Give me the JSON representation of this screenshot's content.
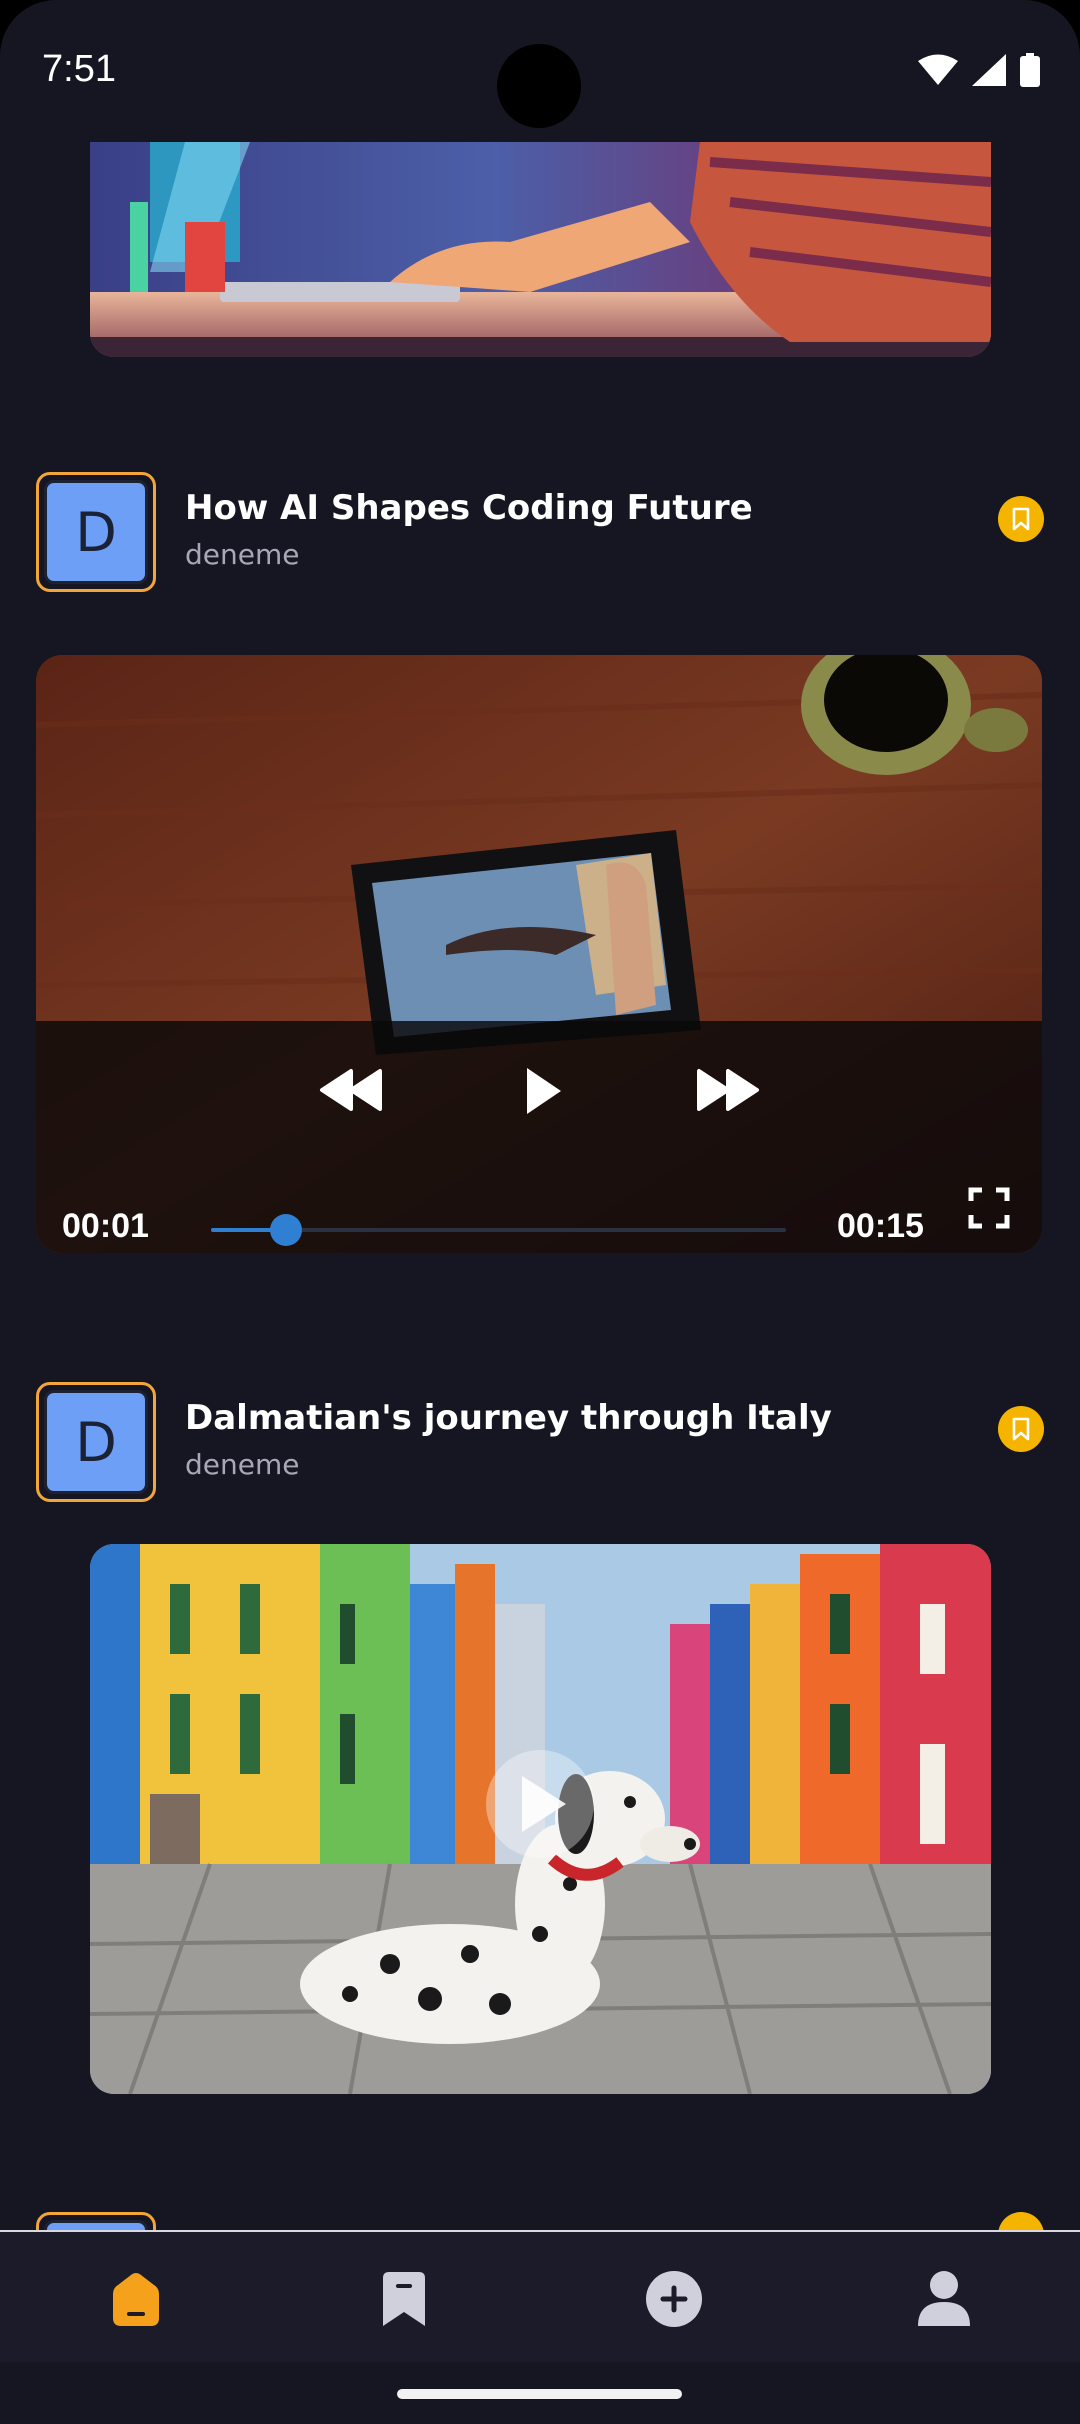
{
  "status_bar": {
    "time": "7:51",
    "icons": [
      "wifi-icon",
      "cellular-signal-icon",
      "battery-icon"
    ]
  },
  "feed": {
    "posts": [
      {
        "title": "How AI Shapes Coding Future",
        "author": "deneme",
        "avatar_letter": "D",
        "bookmarked": true,
        "media_type": "video",
        "player": {
          "current_time": "00:01",
          "duration": "00:15",
          "progress": 0.13
        }
      },
      {
        "title": "Dalmatian's journey through Italy",
        "author": "deneme",
        "avatar_letter": "D",
        "bookmarked": true,
        "media_type": "video-thumbnail"
      }
    ]
  },
  "bottom_nav": {
    "items": [
      {
        "icon": "home-icon",
        "active": true
      },
      {
        "icon": "bookmark-icon",
        "active": false
      },
      {
        "icon": "add-circle-icon",
        "active": false
      },
      {
        "icon": "profile-icon",
        "active": false
      }
    ],
    "colors": {
      "active": "#f5a11b",
      "inactive": "#cfd0dc"
    }
  },
  "colors": {
    "background": "#161622",
    "accent": "#f2a63a",
    "bookmark_badge": "#f5b400",
    "avatar_bg": "#6e9ff7",
    "progress": "#2f7fd2"
  }
}
